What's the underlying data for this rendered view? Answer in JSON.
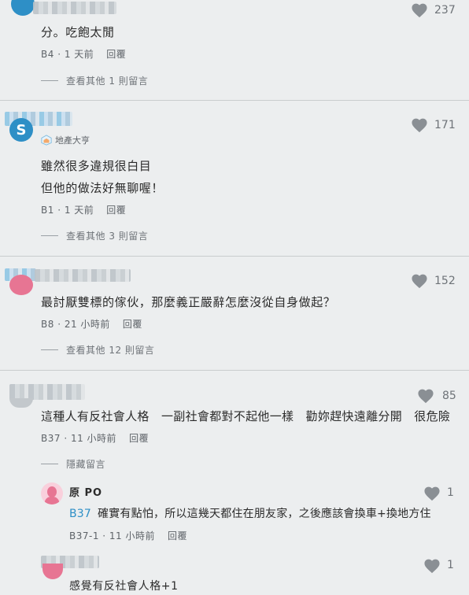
{
  "comments": [
    {
      "likes": "237",
      "text": "分。吃飽太閒",
      "floor": "B4",
      "time": "1 天前",
      "reply_label": "回覆",
      "more_replies": "查看其他 1 則留言"
    },
    {
      "likes": "171",
      "avatar_letter": "S",
      "badge": "地產大亨",
      "text_line1": "雖然很多違規很白目",
      "text_line2": "但他的做法好無聊喔！",
      "floor": "B1",
      "time": "1 天前",
      "reply_label": "回覆",
      "more_replies": "查看其他 3 則留言"
    },
    {
      "likes": "152",
      "text": "最討厭雙標的傢伙，那麼義正嚴辭怎麼沒從自身做起？",
      "floor": "B8",
      "time": "21 小時前",
      "reply_label": "回覆",
      "more_replies": "查看其他 12 則留言"
    },
    {
      "likes": "85",
      "text": "這種人有反社會人格　一副社會都對不起他一樣　勸妳趕快遠離分開　很危險",
      "floor": "B37",
      "time": "11 小時前",
      "reply_label": "回覆",
      "hide_replies": "隱藏留言"
    }
  ],
  "replies": [
    {
      "author": "原 PO",
      "likes": "1",
      "mention": "B37",
      "text": "確實有點怕，所以這幾天都住在朋友家，之後應該會換車+換地方住",
      "floor": "B37-1",
      "time": "11 小時前",
      "reply_label": "回覆"
    },
    {
      "likes": "1",
      "text": "感覺有反社會人格+1"
    }
  ],
  "colors": {
    "background": "#eceeef",
    "link": "#2e8fc6",
    "heart": "#8a8f94"
  },
  "icons": {
    "like": "heart-icon",
    "badge": "house-badge-icon",
    "avatar_pink": "woman-silhouette-icon"
  }
}
